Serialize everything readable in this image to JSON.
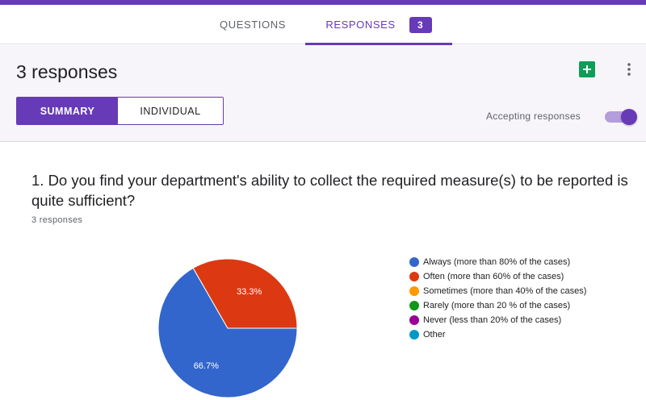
{
  "tabs": {
    "questions_label": "QUESTIONS",
    "responses_label": "RESPONSES",
    "responses_badge": "3"
  },
  "summary": {
    "title": "3 responses",
    "toggle_summary": "SUMMARY",
    "toggle_individual": "INDIVIDUAL",
    "accepting_label": "Accepting responses",
    "accepting_on": true,
    "sheets_icon": "sheets-icon",
    "more_icon": "more-vert-icon"
  },
  "question": {
    "text": "1. Do you find your department's ability to collect the required measure(s) to be reported is quite sufficient?",
    "response_count": "3 responses"
  },
  "colors": {
    "accent": "#673ab7"
  },
  "chart_data": {
    "type": "pie",
    "slices": [
      {
        "label": "Always (more than 80% of the cases)",
        "value": 66.7,
        "display": "66.7%",
        "color": "#3366cc"
      },
      {
        "label": "Often (more than 60% of the cases)",
        "value": 33.3,
        "display": "33.3%",
        "color": "#dc3912"
      },
      {
        "label": "Sometimes (more than 40% of the cases)",
        "value": 0,
        "display": "",
        "color": "#ff9900"
      },
      {
        "label": "Rarely (more than 20 % of the cases)",
        "value": 0,
        "display": "",
        "color": "#109618"
      },
      {
        "label": "Never (less than 20% of the cases)",
        "value": 0,
        "display": "",
        "color": "#990099"
      },
      {
        "label": "Other",
        "value": 0,
        "display": "",
        "color": "#0099c6"
      }
    ],
    "legend_position": "right"
  }
}
